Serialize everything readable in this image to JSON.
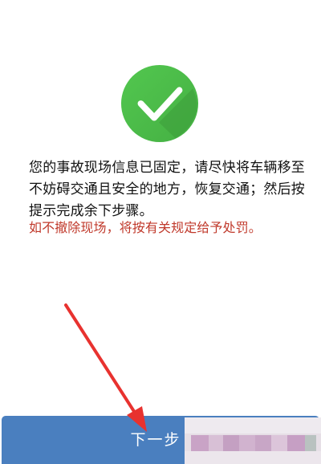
{
  "result": {
    "icon": "check-circle-icon",
    "icon_color": "#4cc24a",
    "message_lines": [
      "您的事故现场信息已固定，请尽快将车辆移至",
      "不妨碍交通且安全的地方，恢复交通；然后按",
      "提示完成余下步骤。"
    ],
    "warning": "如不撤除现场，将按有关规定给予处罚。",
    "warning_color": "#c0392b"
  },
  "footer": {
    "next_label": "下一步",
    "button_color": "#4a7fbf"
  },
  "annotation": {
    "arrow_icon": "red-pointer-arrow-icon",
    "arrow_color": "#e8322f",
    "mosaic": "pixelated-blur-region"
  }
}
